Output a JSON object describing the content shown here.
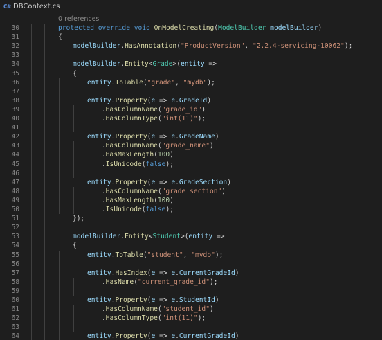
{
  "tab": {
    "icon": "csharp-file-icon",
    "icon_text": "C#",
    "filename": "DBContext.cs"
  },
  "codelens": "0 references",
  "colors": {
    "keyword": "#569cd6",
    "method": "#dcdcaa",
    "type": "#4ec9b0",
    "string": "#ce9178",
    "parameter": "#9cdcfe",
    "number": "#b5cea8",
    "plain": "#d4d4d4",
    "line_number": "#858585",
    "background": "#1e1e1e"
  },
  "lines": [
    {
      "n": "30",
      "indent": 0,
      "tokens": [
        [
          "kw",
          "protected"
        ],
        [
          "pl",
          " "
        ],
        [
          "kw",
          "override"
        ],
        [
          "pl",
          " "
        ],
        [
          "kw",
          "void"
        ],
        [
          "pl",
          " "
        ],
        [
          "mt",
          "OnModelCreating"
        ],
        [
          "pl",
          "("
        ],
        [
          "ty",
          "ModelBuilder"
        ],
        [
          "pl",
          " "
        ],
        [
          "pm",
          "modelBuilder"
        ],
        [
          "pl",
          ")"
        ]
      ]
    },
    {
      "n": "31",
      "indent": 0,
      "tokens": [
        [
          "pl",
          "{"
        ]
      ]
    },
    {
      "n": "32",
      "indent": 1,
      "tokens": [
        [
          "pm",
          "modelBuilder"
        ],
        [
          "pl",
          "."
        ],
        [
          "mt",
          "HasAnnotation"
        ],
        [
          "pl",
          "("
        ],
        [
          "st",
          "\"ProductVersion\""
        ],
        [
          "pl",
          ", "
        ],
        [
          "st",
          "\"2.2.4-servicing-10062\""
        ],
        [
          "pl",
          ");"
        ]
      ]
    },
    {
      "n": "33",
      "indent": 0,
      "tokens": []
    },
    {
      "n": "34",
      "indent": 1,
      "tokens": [
        [
          "pm",
          "modelBuilder"
        ],
        [
          "pl",
          "."
        ],
        [
          "mt",
          "Entity"
        ],
        [
          "pl",
          "<"
        ],
        [
          "ty",
          "Grade"
        ],
        [
          "pl",
          ">("
        ],
        [
          "pm",
          "entity"
        ],
        [
          "pl",
          " =>"
        ]
      ]
    },
    {
      "n": "35",
      "indent": 1,
      "tokens": [
        [
          "pl",
          "{"
        ]
      ]
    },
    {
      "n": "36",
      "indent": 2,
      "tokens": [
        [
          "pm",
          "entity"
        ],
        [
          "pl",
          "."
        ],
        [
          "mt",
          "ToTable"
        ],
        [
          "pl",
          "("
        ],
        [
          "st",
          "\"grade\""
        ],
        [
          "pl",
          ", "
        ],
        [
          "st",
          "\"mydb\""
        ],
        [
          "pl",
          ");"
        ]
      ]
    },
    {
      "n": "37",
      "indent": 0,
      "tokens": []
    },
    {
      "n": "38",
      "indent": 2,
      "tokens": [
        [
          "pm",
          "entity"
        ],
        [
          "pl",
          "."
        ],
        [
          "mt",
          "Property"
        ],
        [
          "pl",
          "("
        ],
        [
          "pm",
          "e"
        ],
        [
          "pl",
          " => "
        ],
        [
          "pm",
          "e"
        ],
        [
          "pl",
          "."
        ],
        [
          "pm",
          "GradeId"
        ],
        [
          "pl",
          ")"
        ]
      ]
    },
    {
      "n": "39",
      "indent": 3,
      "tokens": [
        [
          "pl",
          "."
        ],
        [
          "mt",
          "HasColumnName"
        ],
        [
          "pl",
          "("
        ],
        [
          "st",
          "\"grade_id\""
        ],
        [
          "pl",
          ")"
        ]
      ]
    },
    {
      "n": "40",
      "indent": 3,
      "tokens": [
        [
          "pl",
          "."
        ],
        [
          "mt",
          "HasColumnType"
        ],
        [
          "pl",
          "("
        ],
        [
          "st",
          "\"int(11)\""
        ],
        [
          "pl",
          ");"
        ]
      ]
    },
    {
      "n": "41",
      "indent": 0,
      "tokens": []
    },
    {
      "n": "42",
      "indent": 2,
      "tokens": [
        [
          "pm",
          "entity"
        ],
        [
          "pl",
          "."
        ],
        [
          "mt",
          "Property"
        ],
        [
          "pl",
          "("
        ],
        [
          "pm",
          "e"
        ],
        [
          "pl",
          " => "
        ],
        [
          "pm",
          "e"
        ],
        [
          "pl",
          "."
        ],
        [
          "pm",
          "GradeName"
        ],
        [
          "pl",
          ")"
        ]
      ]
    },
    {
      "n": "43",
      "indent": 3,
      "tokens": [
        [
          "pl",
          "."
        ],
        [
          "mt",
          "HasColumnName"
        ],
        [
          "pl",
          "("
        ],
        [
          "st",
          "\"grade_name\""
        ],
        [
          "pl",
          ")"
        ]
      ]
    },
    {
      "n": "44",
      "indent": 3,
      "tokens": [
        [
          "pl",
          "."
        ],
        [
          "mt",
          "HasMaxLength"
        ],
        [
          "pl",
          "("
        ],
        [
          "nu",
          "100"
        ],
        [
          "pl",
          ")"
        ]
      ]
    },
    {
      "n": "45",
      "indent": 3,
      "tokens": [
        [
          "pl",
          "."
        ],
        [
          "mt",
          "IsUnicode"
        ],
        [
          "pl",
          "("
        ],
        [
          "kw",
          "false"
        ],
        [
          "pl",
          ");"
        ]
      ]
    },
    {
      "n": "46",
      "indent": 0,
      "tokens": []
    },
    {
      "n": "47",
      "indent": 2,
      "tokens": [
        [
          "pm",
          "entity"
        ],
        [
          "pl",
          "."
        ],
        [
          "mt",
          "Property"
        ],
        [
          "pl",
          "("
        ],
        [
          "pm",
          "e"
        ],
        [
          "pl",
          " => "
        ],
        [
          "pm",
          "e"
        ],
        [
          "pl",
          "."
        ],
        [
          "pm",
          "GradeSection"
        ],
        [
          "pl",
          ")"
        ]
      ]
    },
    {
      "n": "48",
      "indent": 3,
      "tokens": [
        [
          "pl",
          "."
        ],
        [
          "mt",
          "HasColumnName"
        ],
        [
          "pl",
          "("
        ],
        [
          "st",
          "\"grade_section\""
        ],
        [
          "pl",
          ")"
        ]
      ]
    },
    {
      "n": "49",
      "indent": 3,
      "tokens": [
        [
          "pl",
          "."
        ],
        [
          "mt",
          "HasMaxLength"
        ],
        [
          "pl",
          "("
        ],
        [
          "nu",
          "100"
        ],
        [
          "pl",
          ")"
        ]
      ]
    },
    {
      "n": "50",
      "indent": 3,
      "tokens": [
        [
          "pl",
          "."
        ],
        [
          "mt",
          "IsUnicode"
        ],
        [
          "pl",
          "("
        ],
        [
          "kw",
          "false"
        ],
        [
          "pl",
          ");"
        ]
      ]
    },
    {
      "n": "51",
      "indent": 1,
      "tokens": [
        [
          "pl",
          "});"
        ]
      ]
    },
    {
      "n": "52",
      "indent": 0,
      "tokens": []
    },
    {
      "n": "53",
      "indent": 1,
      "tokens": [
        [
          "pm",
          "modelBuilder"
        ],
        [
          "pl",
          "."
        ],
        [
          "mt",
          "Entity"
        ],
        [
          "pl",
          "<"
        ],
        [
          "ty",
          "Student"
        ],
        [
          "pl",
          ">("
        ],
        [
          "pm",
          "entity"
        ],
        [
          "pl",
          " =>"
        ]
      ]
    },
    {
      "n": "54",
      "indent": 1,
      "tokens": [
        [
          "pl",
          "{"
        ]
      ]
    },
    {
      "n": "55",
      "indent": 2,
      "tokens": [
        [
          "pm",
          "entity"
        ],
        [
          "pl",
          "."
        ],
        [
          "mt",
          "ToTable"
        ],
        [
          "pl",
          "("
        ],
        [
          "st",
          "\"student\""
        ],
        [
          "pl",
          ", "
        ],
        [
          "st",
          "\"mydb\""
        ],
        [
          "pl",
          ");"
        ]
      ]
    },
    {
      "n": "56",
      "indent": 0,
      "tokens": []
    },
    {
      "n": "57",
      "indent": 2,
      "tokens": [
        [
          "pm",
          "entity"
        ],
        [
          "pl",
          "."
        ],
        [
          "mt",
          "HasIndex"
        ],
        [
          "pl",
          "("
        ],
        [
          "pm",
          "e"
        ],
        [
          "pl",
          " => "
        ],
        [
          "pm",
          "e"
        ],
        [
          "pl",
          "."
        ],
        [
          "pm",
          "CurrentGradeId"
        ],
        [
          "pl",
          ")"
        ]
      ]
    },
    {
      "n": "58",
      "indent": 3,
      "tokens": [
        [
          "pl",
          "."
        ],
        [
          "mt",
          "HasName"
        ],
        [
          "pl",
          "("
        ],
        [
          "st",
          "\"current_grade_id\""
        ],
        [
          "pl",
          ");"
        ]
      ]
    },
    {
      "n": "59",
      "indent": 0,
      "tokens": []
    },
    {
      "n": "60",
      "indent": 2,
      "tokens": [
        [
          "pm",
          "entity"
        ],
        [
          "pl",
          "."
        ],
        [
          "mt",
          "Property"
        ],
        [
          "pl",
          "("
        ],
        [
          "pm",
          "e"
        ],
        [
          "pl",
          " => "
        ],
        [
          "pm",
          "e"
        ],
        [
          "pl",
          "."
        ],
        [
          "pm",
          "StudentId"
        ],
        [
          "pl",
          ")"
        ]
      ]
    },
    {
      "n": "61",
      "indent": 3,
      "tokens": [
        [
          "pl",
          "."
        ],
        [
          "mt",
          "HasColumnName"
        ],
        [
          "pl",
          "("
        ],
        [
          "st",
          "\"student_id\""
        ],
        [
          "pl",
          ")"
        ]
      ]
    },
    {
      "n": "62",
      "indent": 3,
      "tokens": [
        [
          "pl",
          "."
        ],
        [
          "mt",
          "HasColumnType"
        ],
        [
          "pl",
          "("
        ],
        [
          "st",
          "\"int(11)\""
        ],
        [
          "pl",
          ");"
        ]
      ]
    },
    {
      "n": "63",
      "indent": 0,
      "tokens": []
    },
    {
      "n": "64",
      "indent": 2,
      "tokens": [
        [
          "pm",
          "entity"
        ],
        [
          "pl",
          "."
        ],
        [
          "mt",
          "Property"
        ],
        [
          "pl",
          "("
        ],
        [
          "pm",
          "e"
        ],
        [
          "pl",
          " => "
        ],
        [
          "pm",
          "e"
        ],
        [
          "pl",
          "."
        ],
        [
          "pm",
          "CurrentGradeId"
        ],
        [
          "pl",
          ")"
        ]
      ]
    }
  ]
}
